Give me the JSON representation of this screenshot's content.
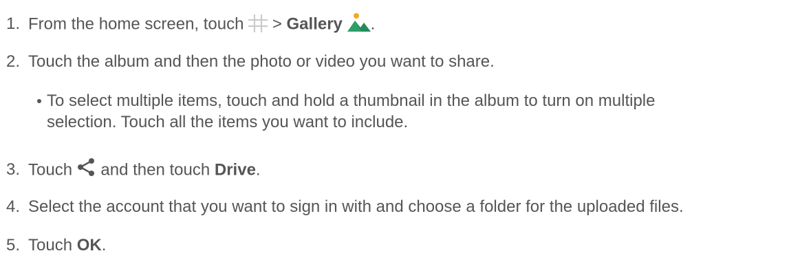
{
  "steps": [
    {
      "number": "1.",
      "text_before": "From the home screen, touch",
      "separator": ">",
      "bold": "Gallery",
      "text_after": ".",
      "icons": [
        "apps-grid-icon",
        "gallery-icon"
      ]
    },
    {
      "number": "2.",
      "text": "Touch the album and then the photo or video you want to share."
    },
    {
      "number": "3.",
      "text_before": "Touch",
      "text_middle": "and then touch",
      "bold": "Drive",
      "text_after": ".",
      "icons": [
        "share-icon"
      ]
    },
    {
      "number": "4.",
      "text": "Select the account that you want to sign in with and choose a folder for the uploaded files."
    },
    {
      "number": "5.",
      "text_before": "Touch",
      "bold": "OK",
      "text_after": "."
    }
  ],
  "bullet": {
    "line1": "To select multiple items, touch and hold a thumbnail in the album to turn on multiple",
    "line2": "selection. Touch all the items you want to include."
  },
  "colors": {
    "text": "#555555",
    "gallery_green": "#2e9e6a",
    "gallery_sun": "#f5a623",
    "grid_icon": "#c8c8c8",
    "share_icon": "#555555"
  }
}
